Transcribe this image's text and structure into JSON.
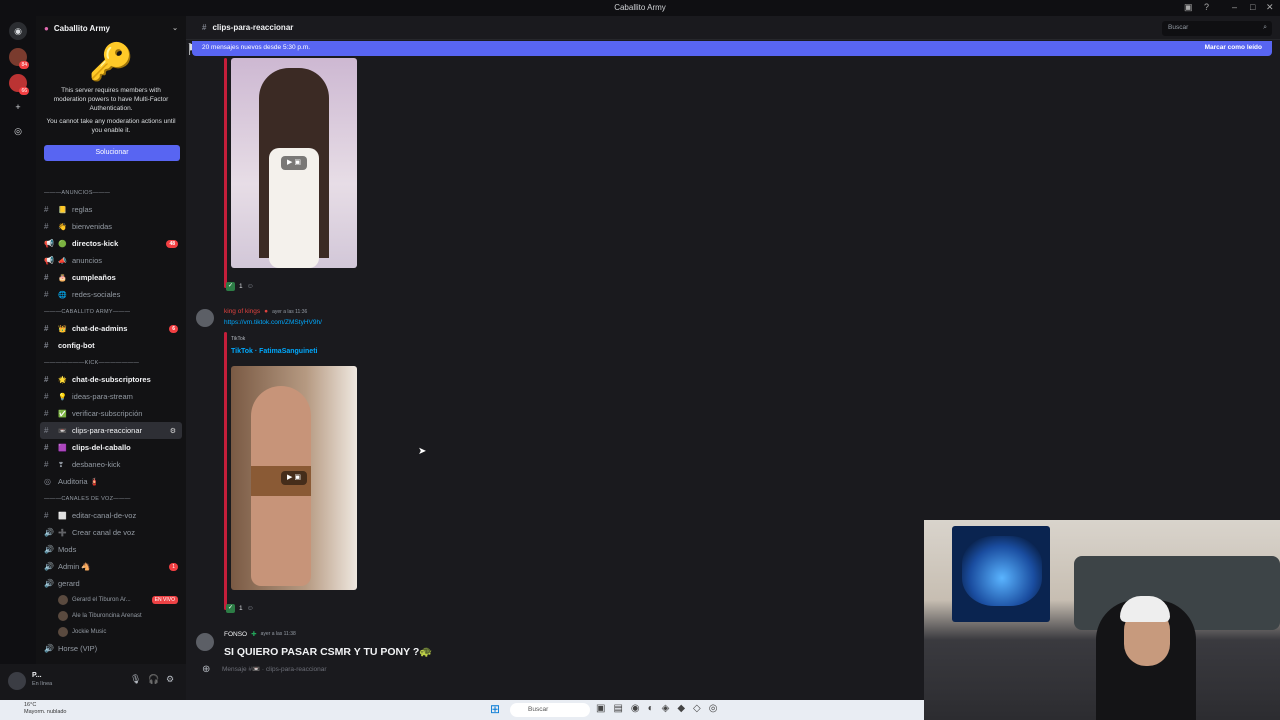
{
  "window": {
    "title": "Caballito Army"
  },
  "servers": [
    {
      "name": "home",
      "badge": ""
    },
    {
      "name": "server-1",
      "badge": "84"
    },
    {
      "name": "server-2",
      "badge": "66"
    },
    {
      "name": "add",
      "badge": ""
    },
    {
      "name": "discover",
      "badge": ""
    }
  ],
  "server": {
    "name": "Caballito Army"
  },
  "mfa": {
    "text1": "This server requires members with moderation powers to have Multi-Factor Authentication.",
    "text2": "You cannot take any moderation actions until you enable it.",
    "button": "Solucionar"
  },
  "channels": [
    {
      "type": "cat",
      "label": "———ANUNCIOS———"
    },
    {
      "type": "ch",
      "emoji": "📒",
      "label": "reglas"
    },
    {
      "type": "ch",
      "emoji": "👋",
      "label": "bienvenidas"
    },
    {
      "type": "ch",
      "emoji": "🟢",
      "label": "directos-kick",
      "unread": true,
      "count": "48",
      "icon": "📢"
    },
    {
      "type": "ch",
      "emoji": "📣",
      "label": "anuncios",
      "icon": "📢"
    },
    {
      "type": "ch",
      "emoji": "🎂",
      "label": "cumpleaños",
      "unread": true
    },
    {
      "type": "ch",
      "emoji": "🌐",
      "label": "redes-sociales"
    },
    {
      "type": "cat",
      "label": "———CABALLITO ARMY———"
    },
    {
      "type": "ch",
      "emoji": "👑",
      "label": "chat-de-admins",
      "unread": true,
      "count": "6"
    },
    {
      "type": "ch",
      "emoji": "",
      "label": "config-bot",
      "unread": true
    },
    {
      "type": "cat",
      "label": "———————KICK———————"
    },
    {
      "type": "ch",
      "emoji": "🌟",
      "label": "chat-de-subscriptores",
      "unread": true
    },
    {
      "type": "ch",
      "emoji": "💡",
      "label": "ideas-para-stream"
    },
    {
      "type": "ch",
      "emoji": "✅",
      "label": "verificar-subscripción"
    },
    {
      "type": "ch",
      "emoji": "📼",
      "label": "clips-para-reaccionar",
      "active": true
    },
    {
      "type": "ch",
      "emoji": "🟪",
      "label": "clips-del-caballo",
      "unread": true
    },
    {
      "type": "ch",
      "emoji": "❣",
      "label": "desbaneo-kick"
    },
    {
      "type": "ch",
      "emoji": "",
      "label": "Auditoria 🧯",
      "icon": "◎"
    },
    {
      "type": "cat",
      "label": "———CANALES DE VOZ———"
    },
    {
      "type": "ch",
      "emoji": "⬜",
      "label": "editar-canal-de-voz"
    },
    {
      "type": "ch",
      "emoji": "➕",
      "label": "Crear canal de voz",
      "icon": "🔊"
    },
    {
      "type": "ch",
      "emoji": "",
      "label": "Mods",
      "icon": "🔊"
    },
    {
      "type": "ch",
      "emoji": "",
      "label": "Admin 🐴",
      "icon": "🔊",
      "count": "1"
    },
    {
      "type": "ch",
      "emoji": "",
      "label": "gerard",
      "icon": "🔊"
    }
  ],
  "voice_users": [
    {
      "name": "Gerard el Tiburon Ar...",
      "live": "EN VIVO"
    },
    {
      "name": "Ale la Tiburoncina Arenast",
      "live": ""
    },
    {
      "name": "Jockie Music",
      "live": ""
    }
  ],
  "next_channel": "Horse (VIP)",
  "user": {
    "name": "P...",
    "status": "En línea"
  },
  "header": {
    "channel": "clips-para-reaccionar",
    "search": "Buscar"
  },
  "newbar": {
    "text": "20 mensajes nuevos desde 5:30 p.m.",
    "mark": "Marcar como leído"
  },
  "messages": {
    "react1": "1",
    "author2": "king of kings",
    "time2": "ayer a las 11:36",
    "link2": "https://vm.tiktok.com/ZMStyHV9h/",
    "provider2": "TikTok",
    "title2": "TikTok · FatimaSanguineti",
    "react2": "1",
    "author3": "FONSO",
    "time3": "ayer a las 11:38",
    "text3": "SI QUIERO PASAR CSMR Y TU PONY ?🐢"
  },
  "composer": {
    "placeholder": "Mensaje #📼 · clips-para-reaccionar"
  },
  "taskbar": {
    "temp": "16°C",
    "weather": "Mayorm. nublado",
    "search": "Buscar"
  }
}
